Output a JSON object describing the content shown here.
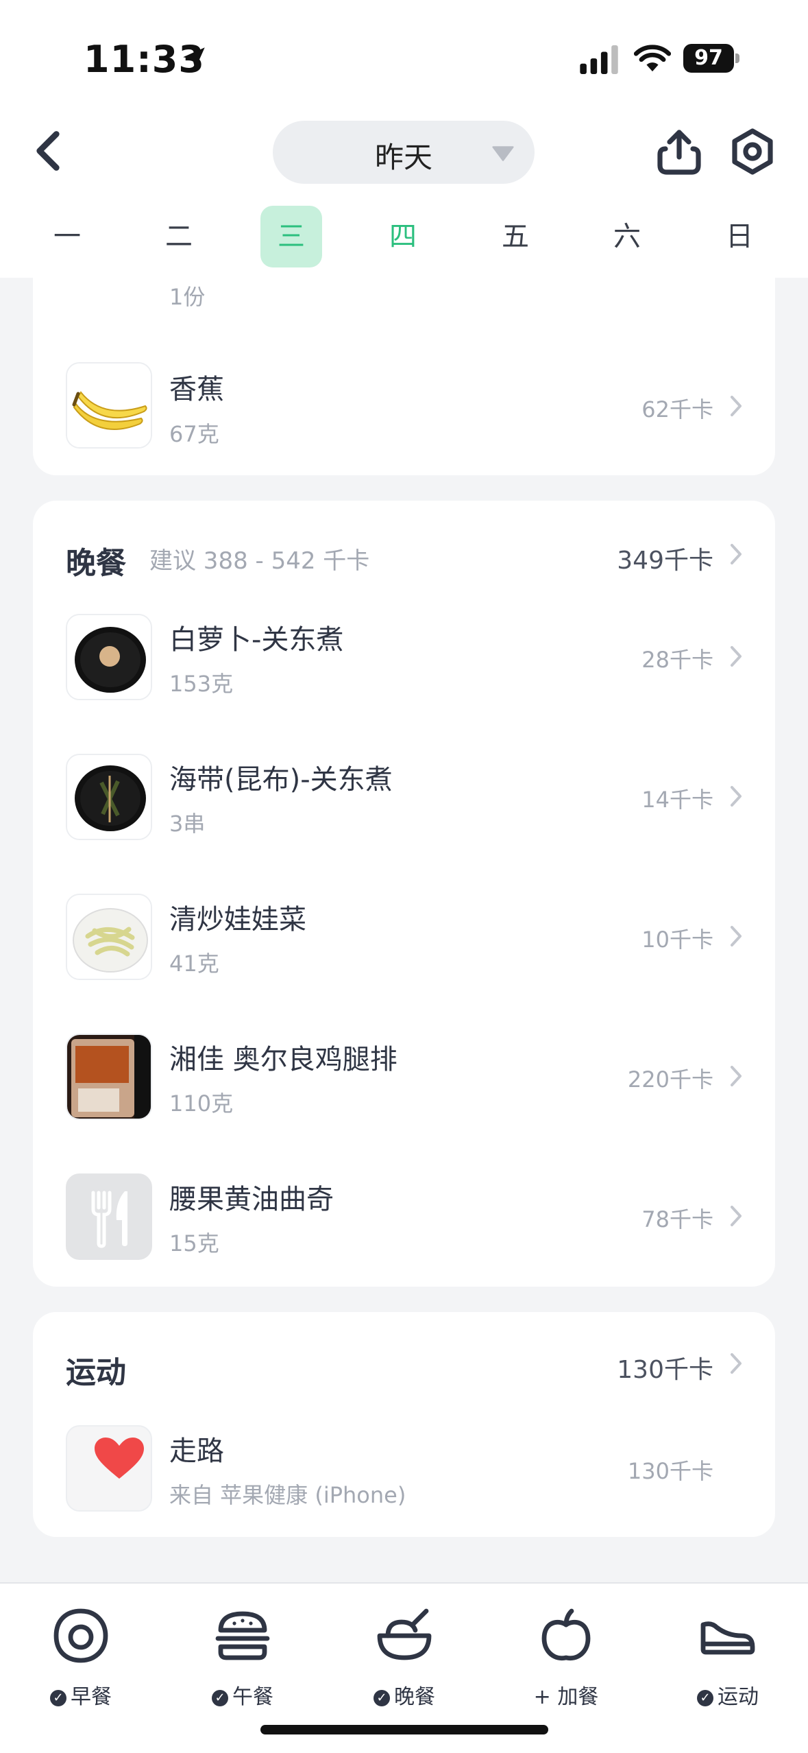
{
  "status_bar": {
    "time": "11:33",
    "battery": "97"
  },
  "header": {
    "date_label": "昨天"
  },
  "weekdays": [
    "一",
    "二",
    "三",
    "四",
    "五",
    "六",
    "日"
  ],
  "lunch": {
    "partial_item": {
      "sub": "1份"
    },
    "items": [
      {
        "name": "香蕉",
        "sub": "67克",
        "cal": "62千卡"
      }
    ]
  },
  "dinner": {
    "title": "晚餐",
    "hint": "建议 388 - 542 千卡",
    "total": "349千卡",
    "items": [
      {
        "name": "白萝卜-关东煮",
        "sub": "153克",
        "cal": "28千卡"
      },
      {
        "name": "海带(昆布)-关东煮",
        "sub": "3串",
        "cal": "14千卡"
      },
      {
        "name": "清炒娃娃菜",
        "sub": "41克",
        "cal": "10千卡"
      },
      {
        "name": "湘佳 奥尔良鸡腿排",
        "sub": "110克",
        "cal": "220千卡"
      },
      {
        "name": "腰果黄油曲奇",
        "sub": "15克",
        "cal": "78千卡"
      }
    ]
  },
  "exercise": {
    "title": "运动",
    "total": "130千卡",
    "items": [
      {
        "name": "走路",
        "sub": "来自 苹果健康 (iPhone)",
        "cal": "130千卡"
      }
    ]
  },
  "tabs": [
    {
      "label": "早餐",
      "icon": "egg-icon",
      "checked": true
    },
    {
      "label": "午餐",
      "icon": "burger-icon",
      "checked": true
    },
    {
      "label": "晚餐",
      "icon": "bowl-icon",
      "checked": true
    },
    {
      "label": "+ 加餐",
      "icon": "apple-icon",
      "checked": false
    },
    {
      "label": "运动",
      "icon": "sneaker-icon",
      "checked": true
    }
  ],
  "colors": {
    "accent": "#2bbf7e",
    "accent_bg": "#c7f0dc",
    "heart": "#f04848"
  }
}
